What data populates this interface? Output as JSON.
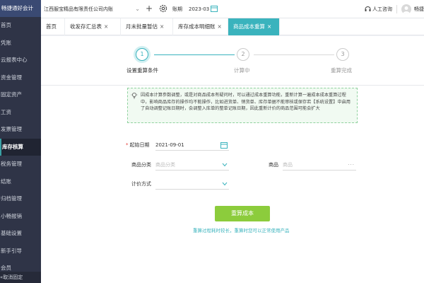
{
  "app": {
    "brand": "畅捷通好会计"
  },
  "sidebar": {
    "items": [
      {
        "label": "首页"
      },
      {
        "label": "凭账"
      },
      {
        "label": "云报表中心"
      },
      {
        "label": "资金管理"
      },
      {
        "label": "固定资产"
      },
      {
        "label": "工资"
      },
      {
        "label": "发票管理"
      },
      {
        "label": "库存核算"
      },
      {
        "label": "税务管理"
      },
      {
        "label": "结账"
      },
      {
        "label": "归档管理"
      },
      {
        "label": "小畅报销"
      },
      {
        "label": "基础设置"
      },
      {
        "label": "新手引导"
      },
      {
        "label": "会员"
      }
    ],
    "active_index": 7,
    "unpin_label": "«取消固定"
  },
  "header": {
    "company": "江西服宝精品有限责任公司内账",
    "period_label": "账期",
    "period_value": "2023-03",
    "support_label": "人工咨询",
    "user_name": "畅捷"
  },
  "tabs": [
    {
      "label": "首页",
      "closable": false
    },
    {
      "label": "收发存汇总表",
      "closable": true
    },
    {
      "label": "月末批量暂估",
      "closable": true
    },
    {
      "label": "库存成本明细账",
      "closable": true
    },
    {
      "label": "商品成本重算",
      "closable": true,
      "active": true
    }
  ],
  "steps": [
    {
      "number": "1",
      "label": "设置重算条件",
      "active": true
    },
    {
      "number": "2",
      "label": "计算中",
      "active": false
    },
    {
      "number": "3",
      "label": "重算完成",
      "active": false
    }
  ],
  "notice": {
    "text": "因成本计算参数调整，或是对商品成本有疑问时，可以通过成本重算功能，重新计算一遍成本成本重算过程中，影响商品库存的操作均不能操作，比如进货单、销货单、库存单据不能审核或保存若【系统设置】中启用了自动调整记账日期时，会调整入库单的整单记账日期，因此重新计价的商品范围可能会扩大"
  },
  "form": {
    "start_date_label": "起始日期",
    "start_date_value": "2021-09-01",
    "category_label": "商品分类",
    "category_placeholder": "商品分类",
    "product_label": "商品",
    "product_placeholder": "商品",
    "pricing_label": "计价方式",
    "pricing_value": ""
  },
  "actions": {
    "recalc_label": "重算成本",
    "hint": "重算过程耗时较长，重算时您可以正常使用产品"
  },
  "colors": {
    "accent": "#3ab3bd",
    "button_green": "#8ccc3c",
    "sidebar_bg": "#2f3447"
  }
}
